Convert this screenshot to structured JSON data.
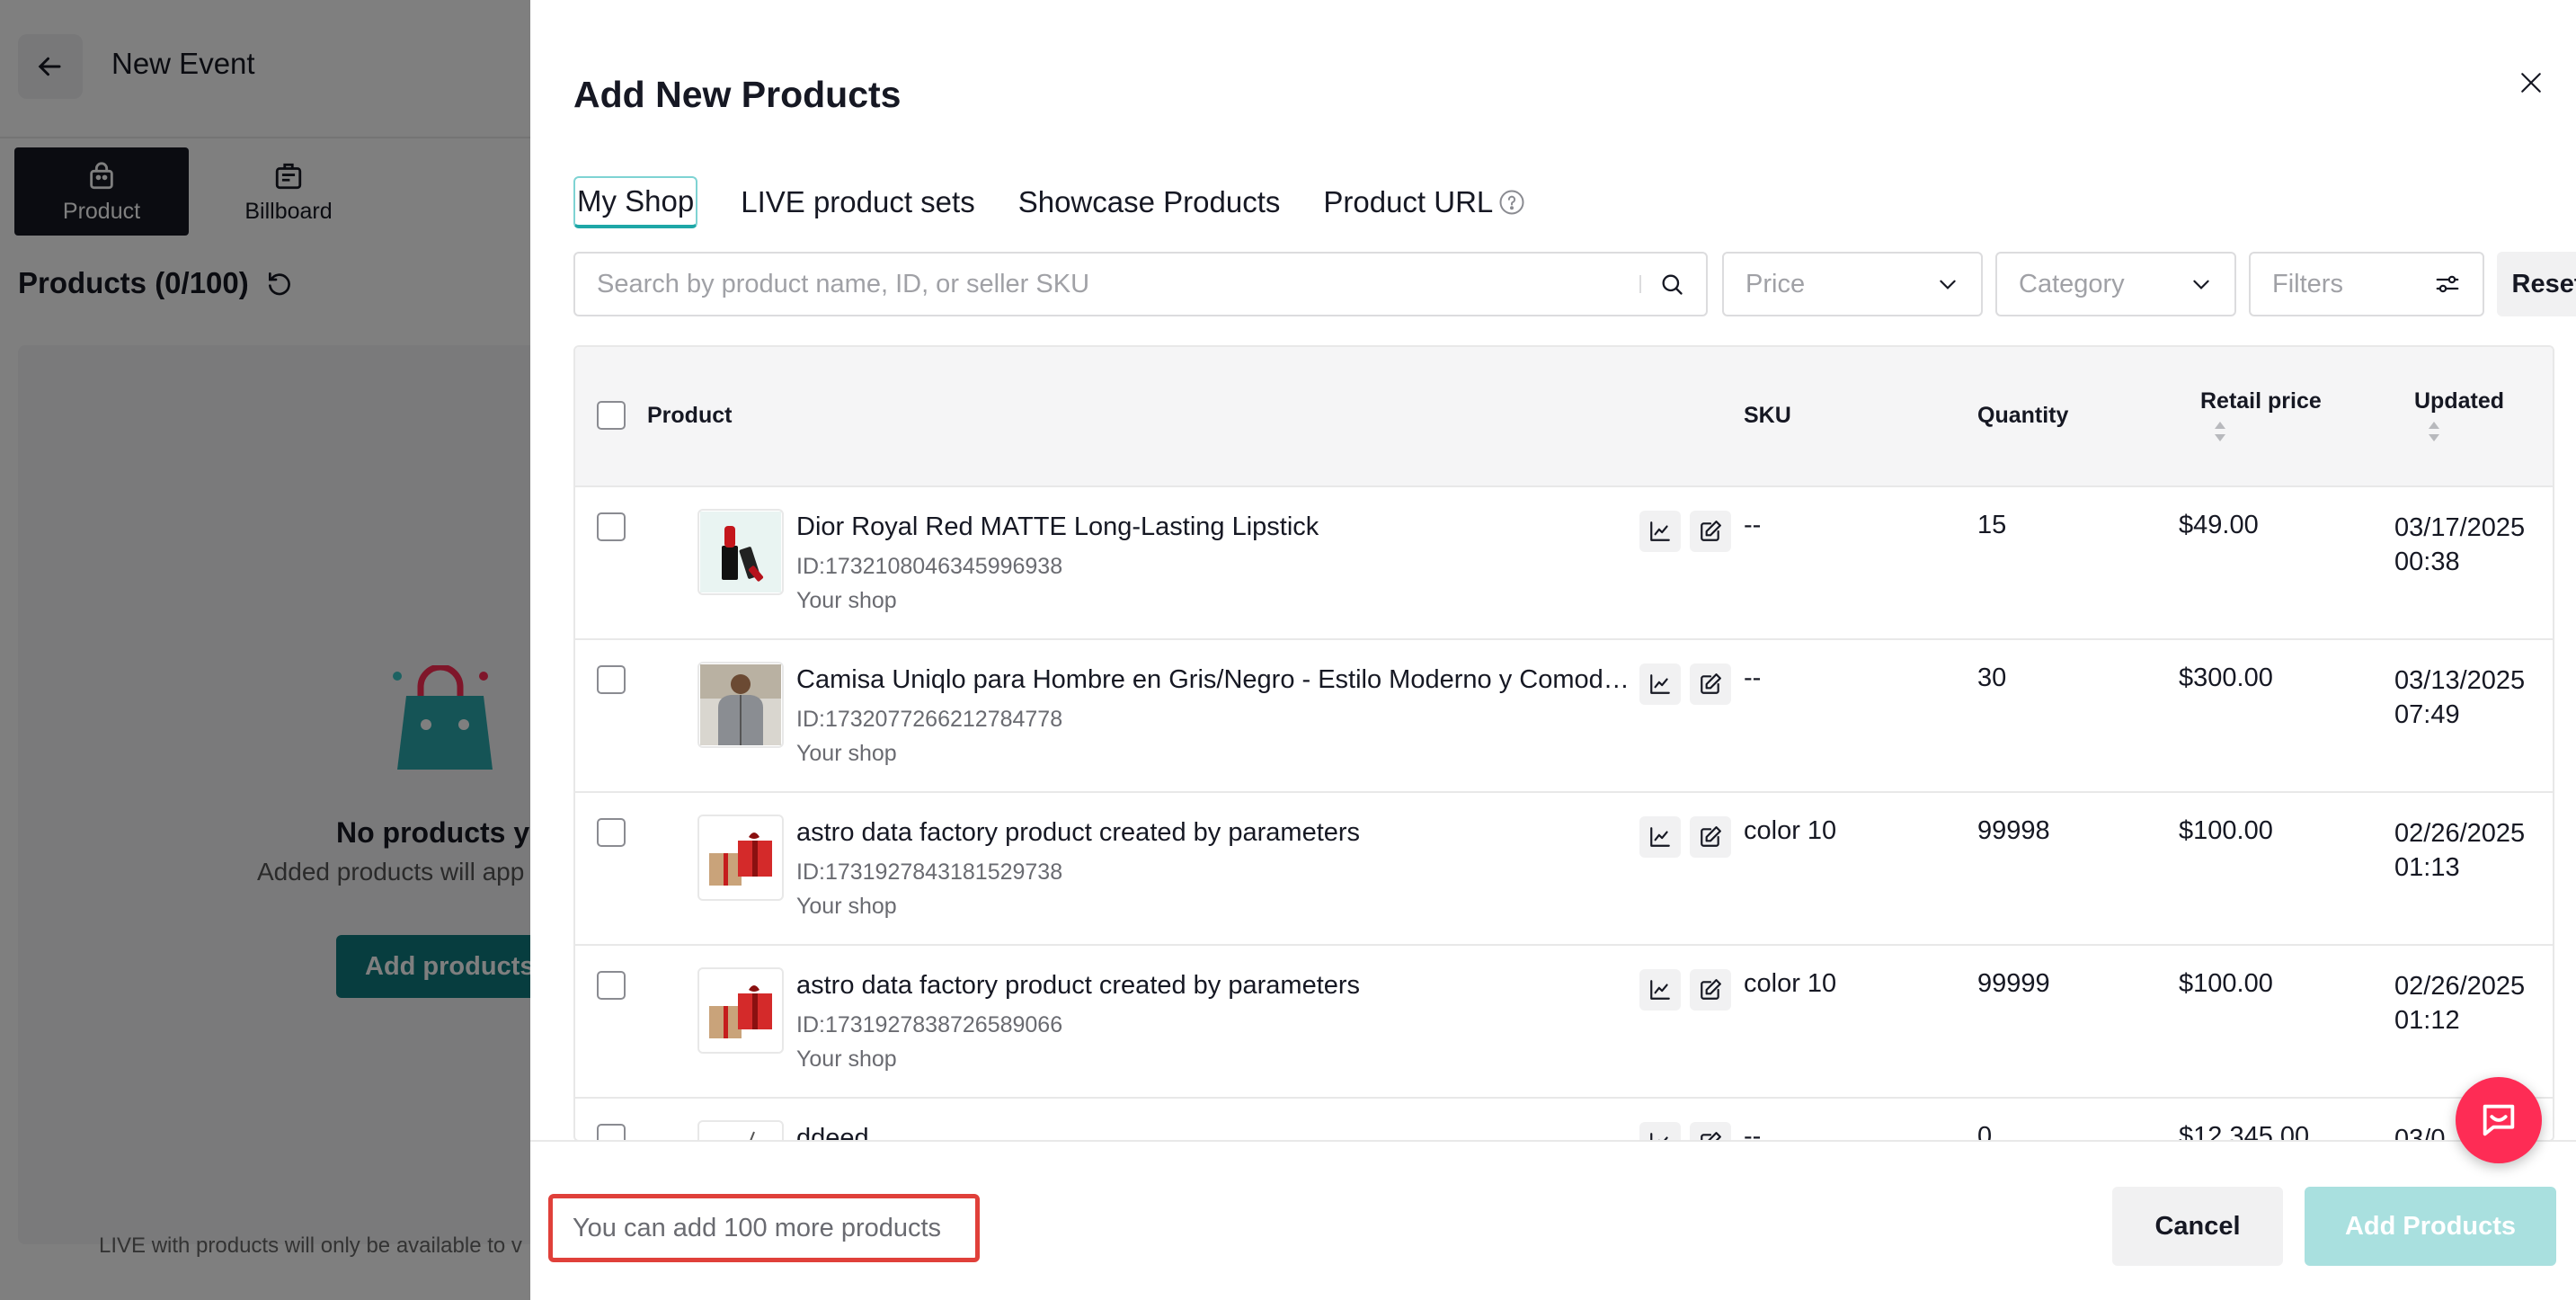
{
  "background": {
    "title": "New Event",
    "tabs": [
      {
        "label": "Product",
        "icon": "shopping-bag-icon",
        "active": true
      },
      {
        "label": "Billboard",
        "icon": "billboard-icon",
        "active": false
      }
    ],
    "products_heading": "Products (0/100)",
    "empty_title": "No products y",
    "empty_subtitle": "Added products will app",
    "add_button": "Add products",
    "footnote": "LIVE with products will only be available to v"
  },
  "drawer": {
    "title": "Add New Products",
    "tabs": [
      {
        "label": "My Shop",
        "active": true
      },
      {
        "label": "LIVE product sets",
        "active": false
      },
      {
        "label": "Showcase Products",
        "active": false
      },
      {
        "label": "Product URL",
        "active": false,
        "help": true
      }
    ],
    "search_placeholder": "Search by product name, ID, or seller SKU",
    "filters": {
      "price": "Price",
      "category": "Category",
      "filters": "Filters",
      "reset": "Reset"
    },
    "columns": {
      "product": "Product",
      "sku": "SKU",
      "quantity": "Quantity",
      "retail_price": "Retail price",
      "updated": "Updated"
    },
    "rows": [
      {
        "name": "Dior Royal Red MATTE Long-Lasting Lipstick",
        "id": "ID:1732108046345996938",
        "shop": "Your shop",
        "sku": "--",
        "quantity": "15",
        "price": "$49.00",
        "updated": "03/17/2025 00:38",
        "thumb": "lipstick"
      },
      {
        "name": "Camisa Uniqlo para Hombre en Gris/Negro - Estilo Moderno y Comodidad",
        "id": "ID:1732077266212784778",
        "shop": "Your shop",
        "sku": "--",
        "quantity": "30",
        "price": "$300.00",
        "updated": "03/13/2025 07:49",
        "thumb": "shirt"
      },
      {
        "name": "astro data factory product created by parameters",
        "id": "ID:1731927843181529738",
        "shop": "Your shop",
        "sku": "color 10",
        "quantity": "99998",
        "price": "$100.00",
        "updated": "02/26/2025 01:13",
        "thumb": "gift"
      },
      {
        "name": "astro data factory product created by parameters",
        "id": "ID:1731927838726589066",
        "shop": "Your shop",
        "sku": "color 10",
        "quantity": "99999",
        "price": "$100.00",
        "updated": "02/26/2025 01:12",
        "thumb": "gift"
      },
      {
        "name": "ddeed",
        "id": "",
        "shop": "",
        "sku": "--",
        "quantity": "0",
        "price": "$12,345.00",
        "updated": "03/0",
        "thumb": "sketch"
      }
    ],
    "footer": {
      "note": "You can add 100 more products",
      "cancel": "Cancel",
      "add": "Add Products"
    }
  },
  "colors": {
    "accent": "#1ea7a7",
    "primary_disabled": "#a9e0df",
    "highlight_border": "#e0403a",
    "fab": "#fe2c55"
  }
}
